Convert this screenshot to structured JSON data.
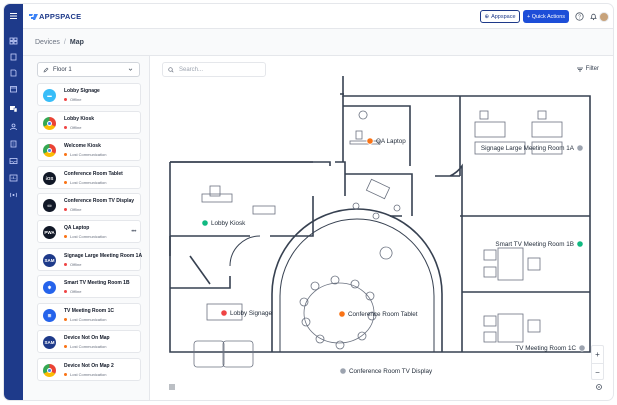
{
  "brand": {
    "logo_text": "APPSPACE"
  },
  "header": {
    "appspace_button": "Appspace",
    "quick_actions_button": "+ Quick Actions"
  },
  "breadcrumb": {
    "parent": "Devices",
    "separator": "/",
    "current": "Map"
  },
  "panel": {
    "floor_select": "Floor 1",
    "devices": [
      {
        "name": "Lobby Signage",
        "status": "Offline",
        "status_color": "#ef4444",
        "icon": "appspace-app-icon",
        "icon_color": "#38bdf8"
      },
      {
        "name": "Lobby Kiosk",
        "status": "Offline",
        "status_color": "#ef4444",
        "icon": "chrome-icon",
        "icon_color": "#ea4335"
      },
      {
        "name": "Welcome Kiosk",
        "status": "Lost Communication",
        "status_color": "#f97316",
        "icon": "chrome-icon",
        "icon_color": "#ea4335"
      },
      {
        "name": "Conference Room Tablet",
        "status": "Lost Communication",
        "status_color": "#f97316",
        "icon": "ios-icon",
        "icon_color": "#111827"
      },
      {
        "name": "Conference Room TV Display",
        "status": "Offline",
        "status_color": "#ef4444",
        "icon": "tv-display-icon",
        "icon_color": "#111827"
      },
      {
        "name": "QA Laptop",
        "status": "Lost Communication",
        "status_color": "#f97316",
        "icon": "pwa-icon",
        "icon_color": "#111827"
      },
      {
        "name": "Signage Large Meeting Room 1A",
        "status": "Offline",
        "status_color": "#ef4444",
        "icon": "samsung-icon",
        "icon_color": "#1e3a8a"
      },
      {
        "name": "Smart TV Meeting Room 1B",
        "status": "Offline",
        "status_color": "#ef4444",
        "icon": "gear-device-icon",
        "icon_color": "#2563eb"
      },
      {
        "name": "TV Meeting Room 1C",
        "status": "Lost Communication",
        "status_color": "#f97316",
        "icon": "windows-icon",
        "icon_color": "#2563eb"
      },
      {
        "name": "Device Not On Map",
        "status": "Lost Communication",
        "status_color": "#f97316",
        "icon": "samsung-icon",
        "icon_color": "#1e3a8a"
      },
      {
        "name": "Device Not On Map 2",
        "status": "Lost Communication",
        "status_color": "#f97316",
        "icon": "chrome-icon",
        "icon_color": "#ea4335"
      }
    ]
  },
  "map": {
    "search_placeholder": "Search...",
    "filter_label": "Filter",
    "zoom_in": "+",
    "zoom_out": "−",
    "pins": [
      {
        "label": "QA Laptop",
        "status_color": "#f97316"
      },
      {
        "label": "Signage Large Meeting Room 1A",
        "status_color": "#9ca3af"
      },
      {
        "label": "Lobby Kiosk",
        "status_color": "#10b981"
      },
      {
        "label": "Smart TV Meeting Room 1B",
        "status_color": "#10b981"
      },
      {
        "label": "Lobby Signage",
        "status_color": "#ef4444"
      },
      {
        "label": "Conference Room Tablet",
        "status_color": "#f97316"
      },
      {
        "label": "TV Meeting Room 1C",
        "status_color": "#9ca3af"
      },
      {
        "label": "Conference Room TV Display",
        "status_color": "#9ca3af"
      }
    ]
  }
}
